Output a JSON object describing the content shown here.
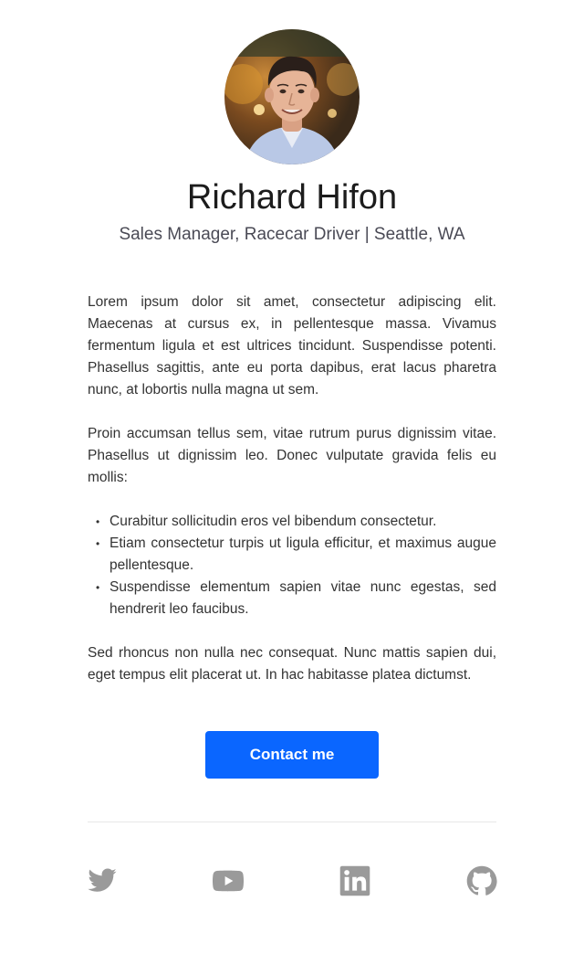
{
  "profile": {
    "name": "Richard Hifon",
    "subtitle": "Sales Manager, Racecar Driver | Seattle, WA"
  },
  "bio": {
    "paragraph_1": "Lorem ipsum dolor sit amet, consectetur adipiscing elit. Maecenas at cursus ex, in pellentesque massa. Vivamus fermentum ligula et est ultrices tincidunt. Suspendisse potenti. Phasellus sagittis, ante eu porta dapibus, erat lacus pharetra nunc, at lobortis nulla magna ut sem.",
    "paragraph_2": "Proin accumsan tellus sem, vitae rutrum purus dignissim vitae. Phasellus ut dignissim leo. Donec vulputate gravida felis eu mollis:",
    "bullets": [
      "Curabitur sollicitudin eros vel bibendum consectetur.",
      "Etiam consectetur turpis ut ligula efficitur, et maximus augue pellentesque.",
      "Suspendisse elementum sapien vitae nunc egestas, sed hendrerit leo faucibus."
    ],
    "paragraph_3": "Sed rhoncus non nulla nec consequat. Nunc mattis sapien dui, eget tempus elit placerat ut. In hac habitasse platea dictumst."
  },
  "cta": {
    "contact_label": "Contact me"
  },
  "social": {
    "icons": [
      "twitter-icon",
      "youtube-icon",
      "linkedin-icon",
      "github-icon"
    ]
  },
  "colors": {
    "accent": "#0a66ff",
    "icon": "#9a9a9a",
    "text": "#333333"
  }
}
